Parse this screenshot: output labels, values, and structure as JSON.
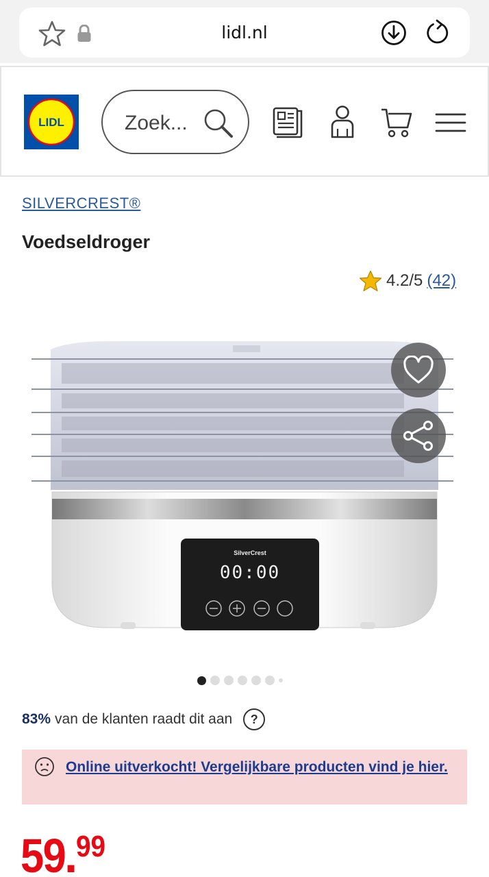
{
  "browser": {
    "url": "lidl.nl",
    "icons": [
      "star-icon",
      "lock-icon",
      "download-icon",
      "reload-icon"
    ]
  },
  "header": {
    "logo_text": "LIDL",
    "search_placeholder": "Zoek...",
    "icons": [
      "search-icon",
      "leaflet-icon",
      "account-icon",
      "cart-icon",
      "menu-icon"
    ],
    "colors": {
      "logo_blue": "#0050aa",
      "logo_yellow": "#fff000",
      "logo_red": "#e60a14"
    }
  },
  "product": {
    "brand": "SILVERCREST®",
    "title": "Voedseldroger",
    "rating": "4.2/5",
    "review_count": "(42)",
    "image_brand": "SilverCrest",
    "display_time": "00:00",
    "gallery": {
      "total": 7,
      "active_index": 0
    },
    "recommend_pct": "83%",
    "recommend_text": "van de klanten raadt dit aan",
    "help_label": "?",
    "soldout_message": "Online uitverkocht! Vergelijkbare producten vind je hier.",
    "price_int": "59",
    "price_sep": ".",
    "price_dec": "99"
  },
  "colors": {
    "price_red": "#e60a14",
    "link_blue": "#1b3c8f",
    "alert_bg": "#f8d7d9",
    "star": "#f5b800"
  }
}
